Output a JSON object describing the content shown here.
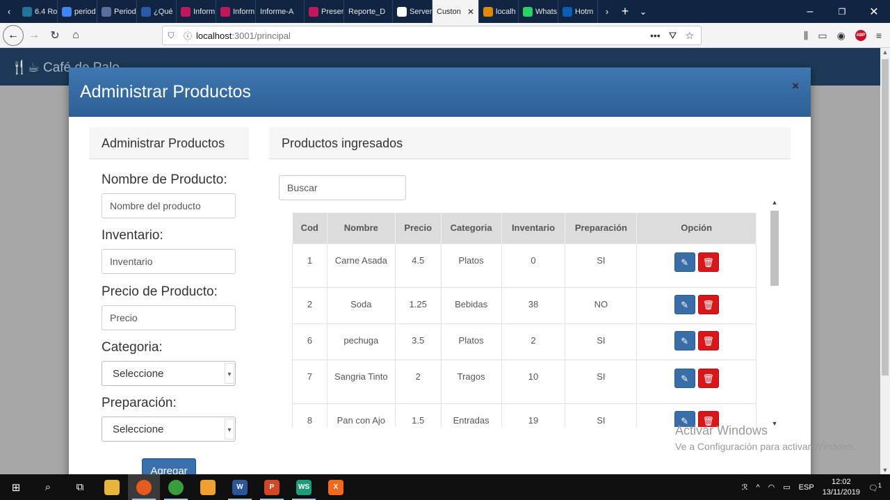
{
  "browser": {
    "tabs": [
      {
        "label": "6.4 Ro",
        "icon": "wordpress-icon",
        "color": "#21759b"
      },
      {
        "label": "period",
        "icon": "google-icon",
        "color": "#4285f4"
      },
      {
        "label": "Period",
        "icon": "browser-icon",
        "color": "#5a6f9a"
      },
      {
        "label": "¿Qué",
        "icon": "r-icon",
        "color": "#2b5aa8"
      },
      {
        "label": "Inform",
        "icon": "pdf-icon",
        "color": "#c2185b"
      },
      {
        "label": "Inform",
        "icon": "pdf-icon",
        "color": "#c2185b"
      },
      {
        "label": "Informe-A",
        "icon": "",
        "color": ""
      },
      {
        "label": "Presen",
        "icon": "pdf-icon",
        "color": "#c2185b"
      },
      {
        "label": "Reporte_D",
        "icon": "",
        "color": ""
      },
      {
        "label": "Server",
        "icon": "warning-icon",
        "color": "#ffffff"
      },
      {
        "label": "Custon",
        "icon": "",
        "color": "",
        "active": true
      },
      {
        "label": "localh",
        "icon": "localhost-icon",
        "color": "#e08a00"
      },
      {
        "label": "Whats",
        "icon": "whatsapp-icon",
        "color": "#25d366"
      },
      {
        "label": "Hotm",
        "icon": "hotmail-icon",
        "color": "#0a5fb4"
      }
    ],
    "url_host": "localhost",
    "url_path": ":3001/principal"
  },
  "app": {
    "brand": "Café de Palo"
  },
  "modal": {
    "title": "Administrar Productos",
    "close_label": "×",
    "form": {
      "header": "Administrar Productos",
      "name_label": "Nombre de Producto:",
      "name_placeholder": "Nombre del producto",
      "inventory_label": "Inventario:",
      "inventory_placeholder": "Inventario",
      "price_label": "Precio de Producto:",
      "price_placeholder": "Precio",
      "category_label": "Categoria:",
      "category_value": "Seleccione",
      "prep_label": "Preparación:",
      "prep_value": "Seleccione",
      "add_label": "Agregar"
    },
    "list": {
      "header": "Productos ingresados",
      "search_placeholder": "Buscar",
      "columns": [
        "Cod",
        "Nombre",
        "Precio",
        "Categoria",
        "Inventario",
        "Preparación",
        "Opción"
      ],
      "rows": [
        {
          "cod": "1",
          "nombre": "Carne Asada",
          "precio": "4.5",
          "categoria": "Platos",
          "inventario": "0",
          "preparacion": "SI"
        },
        {
          "cod": "2",
          "nombre": "Soda",
          "precio": "1.25",
          "categoria": "Bebidas",
          "inventario": "38",
          "preparacion": "NO"
        },
        {
          "cod": "6",
          "nombre": "pechuga",
          "precio": "3.5",
          "categoria": "Platos",
          "inventario": "2",
          "preparacion": "SI"
        },
        {
          "cod": "7",
          "nombre": "Sangria Tinto",
          "precio": "2",
          "categoria": "Tragos",
          "inventario": "10",
          "preparacion": "SI"
        },
        {
          "cod": "8",
          "nombre": "Pan con Ajo",
          "precio": "1.5",
          "categoria": "Entradas",
          "inventario": "19",
          "preparacion": "SI"
        }
      ]
    }
  },
  "watermark": {
    "line1": "Activar Windows",
    "line2": "Ve a Configuración para activar Windows."
  },
  "taskbar": {
    "lang": "ESP",
    "time": "12:02",
    "date": "13/11/2019",
    "notif_count": "1"
  }
}
